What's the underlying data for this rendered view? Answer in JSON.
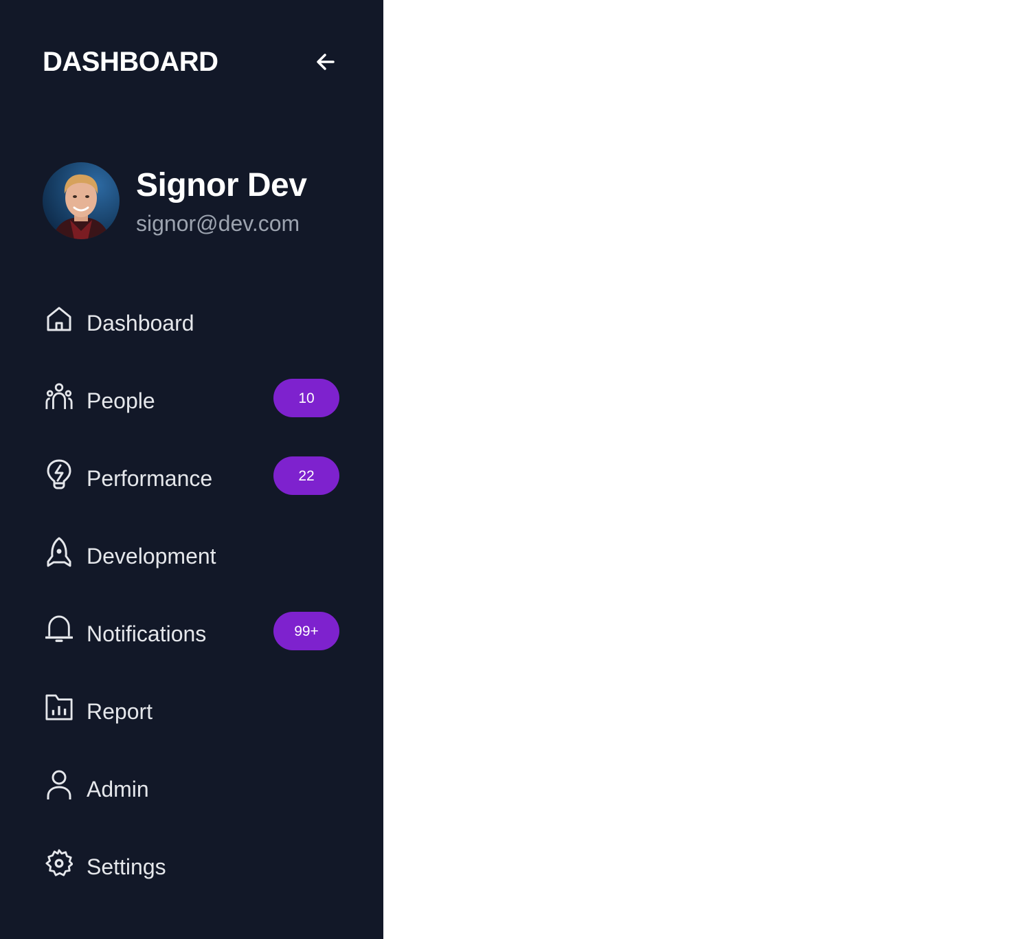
{
  "sidebar": {
    "title": "DASHBOARD",
    "collapse_icon": "arrow-left-icon",
    "profile": {
      "name": "Signor Dev",
      "email": "signor@dev.com"
    },
    "items": [
      {
        "label": "Dashboard",
        "icon": "home-icon",
        "badge": null
      },
      {
        "label": "People",
        "icon": "people-icon",
        "badge": "10"
      },
      {
        "label": "Performance",
        "icon": "lightbulb-icon",
        "badge": "22"
      },
      {
        "label": "Development",
        "icon": "rocket-icon",
        "badge": null
      },
      {
        "label": "Notifications",
        "icon": "bell-icon",
        "badge": "99+"
      },
      {
        "label": "Report",
        "icon": "chart-icon",
        "badge": null
      },
      {
        "label": "Admin",
        "icon": "user-icon",
        "badge": null
      },
      {
        "label": "Settings",
        "icon": "gear-icon",
        "badge": null
      }
    ]
  },
  "colors": {
    "sidebar_bg": "#121828",
    "badge_bg": "#7e22ce",
    "text": "#e5e7eb",
    "muted_text": "#9ca3af",
    "main_bg": "#ffffff"
  }
}
